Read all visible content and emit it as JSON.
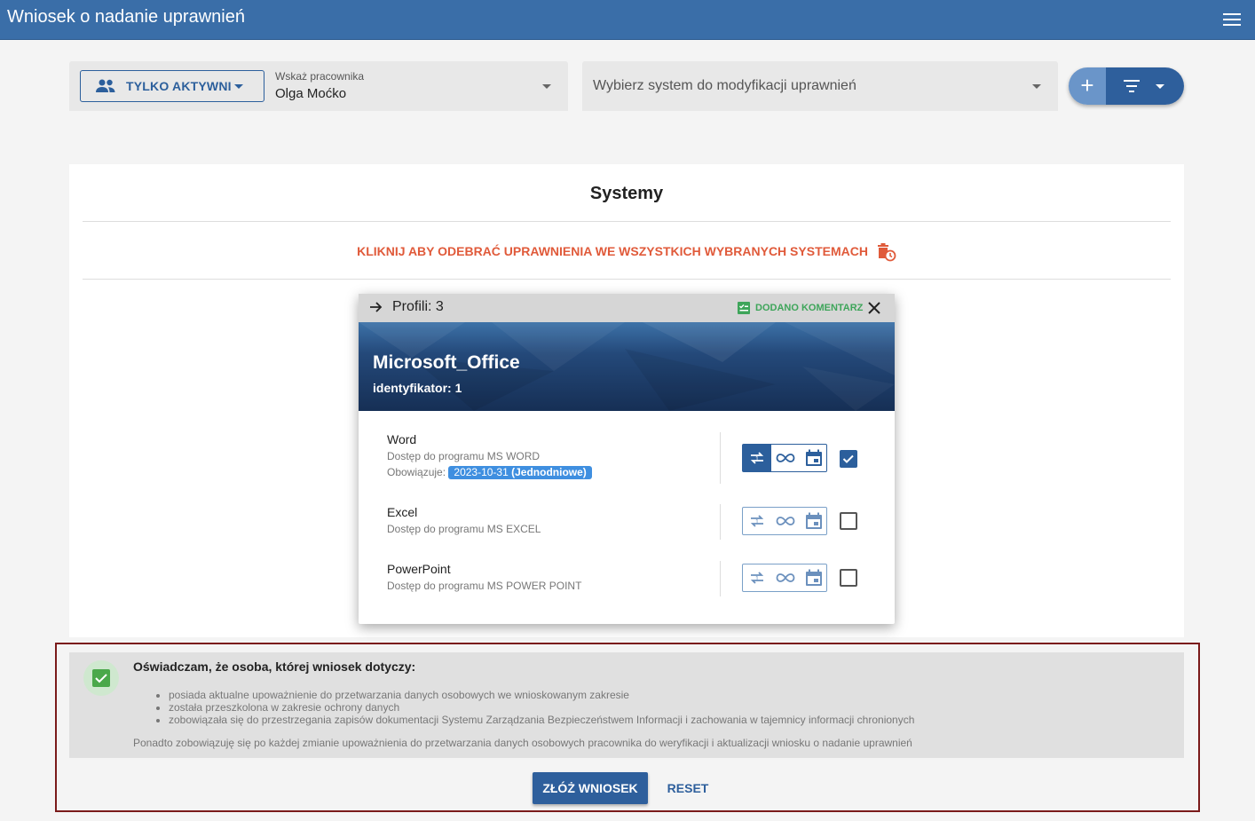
{
  "app": {
    "title": "Wniosek o nadanie uprawnień",
    "menu_icon": "hamburger-icon"
  },
  "filters": {
    "active_toggle_label": "TYLKO AKTYWNI",
    "employee_label": "Wskaż pracownika",
    "employee_value": "Olga Moćko",
    "system_placeholder": "Wybierz system do modyfikacji uprawnień"
  },
  "panel": {
    "title": "Systemy",
    "revoke_all_label": "KLIKNIJ ABY ODEBRAĆ UPRAWNIENIA WE WSZYSTKICH WYBRANYCH SYSTEMACH"
  },
  "system_card": {
    "profiles_label": "Profili: 3",
    "comment_label": "DODANO KOMENTARZ",
    "name": "Microsoft_Office",
    "identifier": "identyfikator: 1",
    "profiles": [
      {
        "name": "Word",
        "description": "Dostęp do programu MS WORD",
        "valid_label": "Obowiązuje:",
        "valid_date": "2023-10-31",
        "valid_type": "(Jednodniowe)",
        "selected": true,
        "mode": "one-time"
      },
      {
        "name": "Excel",
        "description": "Dostęp do programu MS EXCEL",
        "selected": false
      },
      {
        "name": "PowerPoint",
        "description": "Dostęp do programu MS POWER POINT",
        "selected": false
      }
    ]
  },
  "declaration": {
    "checked": true,
    "heading": "Oświadczam, że osoba, której wniosek dotyczy:",
    "items": [
      "posiada aktualne upoważnienie do przetwarzania danych osobowych we wnioskowanym zakresie",
      "została przeszkolona w zakresie ochrony danych",
      "zobowiązała się do przestrzegania zapisów dokumentacji Systemu Zarządzania Bezpieczeństwem Informacji i zachowania w tajemnicy informacji chronionych"
    ],
    "note": "Ponadto zobowiązuję się po każdej zmianie upoważnienia do przetwarzania danych osobowych pracownika do weryfikacji i aktualizacji wniosku o nadanie uprawnień"
  },
  "actions": {
    "submit_label": "ZŁÓŻ WNIOSEK",
    "reset_label": "RESET"
  },
  "colors": {
    "primary": "#2e5f9c",
    "appbar": "#3a6ea8",
    "danger": "#e05a3a",
    "success": "#3ea55a",
    "badge": "#3f8fe0"
  }
}
